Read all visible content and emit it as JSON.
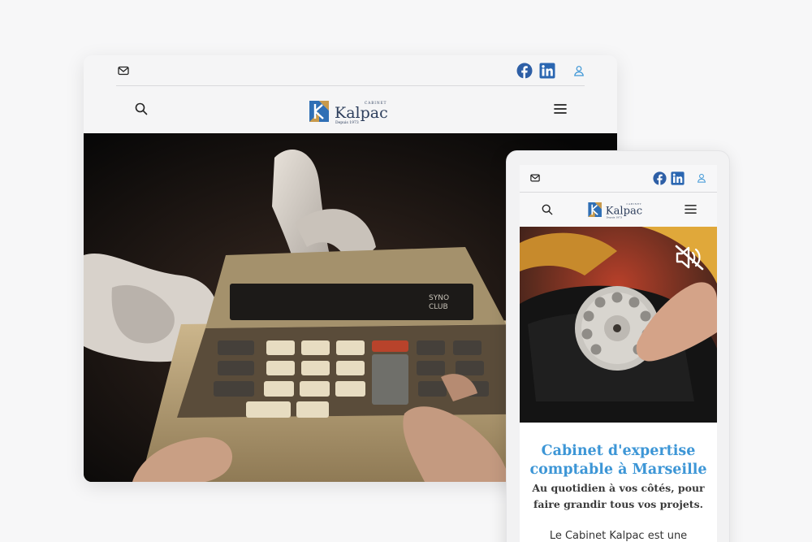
{
  "brand": {
    "name": "Kalpac",
    "small_label": "CABINET",
    "since": "Depuis 1973",
    "colors": {
      "blue": "#2f6fb5",
      "gold": "#c89a4b",
      "navy": "#2d3e5c",
      "accent": "#3d96d6"
    }
  },
  "desktop": {
    "topbar": {
      "icons": [
        "mail-icon",
        "facebook-icon",
        "linkedin-icon",
        "user-icon"
      ]
    },
    "nav": {
      "icons": [
        "search-icon",
        "hamburger-menu-icon"
      ]
    },
    "hero_video": {
      "subject": "calculator-video"
    }
  },
  "mobile": {
    "topbar": {
      "icons": [
        "mail-icon",
        "facebook-icon",
        "linkedin-icon",
        "user-icon"
      ]
    },
    "nav": {
      "icons": [
        "search-icon",
        "hamburger-menu-icon"
      ]
    },
    "hero_video": {
      "subject": "rotary-phone-video",
      "mute_icon": "speaker-muted-icon"
    },
    "content": {
      "title": "Cabinet d'expertise comptable à Marseille",
      "subtitle": "Au quotidien à vos côtés, pour faire grandir tous vos projets.",
      "body_start": "Le Cabinet Kalpac est une"
    }
  }
}
